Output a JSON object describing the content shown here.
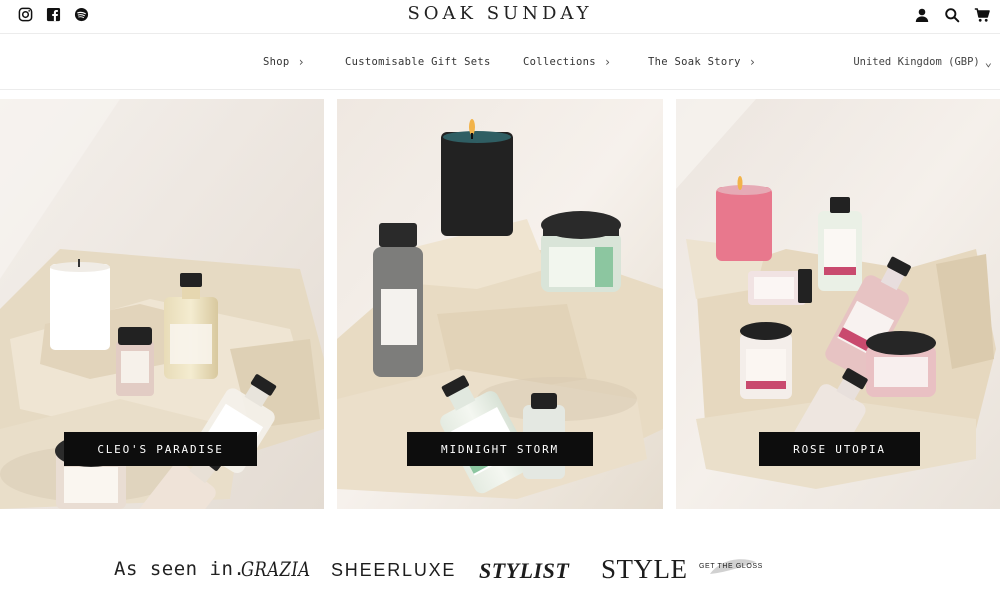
{
  "header": {
    "brand": "SOAK SUNDAY",
    "social_icons": [
      "instagram-icon",
      "facebook-icon",
      "spotify-icon"
    ],
    "util_icons": [
      "account-icon",
      "search-icon",
      "cart-icon"
    ]
  },
  "nav": {
    "items": [
      {
        "label": "Shop",
        "has_chevron": true
      },
      {
        "label": "Customisable Gift Sets",
        "has_chevron": false
      },
      {
        "label": "Collections",
        "has_chevron": true
      },
      {
        "label": "The Soak Story",
        "has_chevron": true
      }
    ],
    "region": "United Kingdom (GBP)"
  },
  "collections": [
    {
      "label": "CLEO'S PARADISE",
      "accent": "#d98f86"
    },
    {
      "label": "MIDNIGHT STORM",
      "accent": "#7fbf9a"
    },
    {
      "label": "ROSE UTOPIA",
      "accent": "#c94a6e"
    }
  ],
  "press": {
    "intro": "As seen in.",
    "logos": [
      "GRAZIA",
      "SHEERLUXE",
      "STYLIST",
      "STYLE",
      "GET THE GLOSS"
    ]
  },
  "colors": {
    "text": "#1a1a1a",
    "label_bg": "#0d0d0d",
    "stone": "#e8dcc6",
    "backdrop": "#f1ece6"
  }
}
